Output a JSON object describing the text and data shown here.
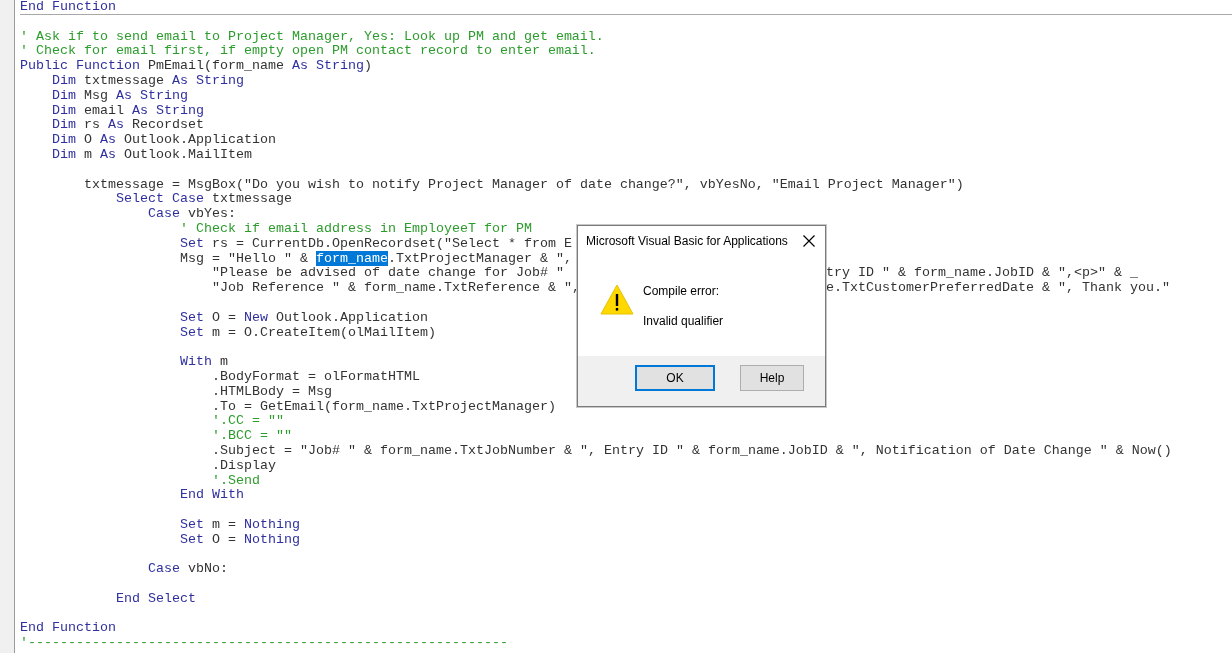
{
  "editor": {
    "lines": [
      {
        "kind": "code",
        "separator": true,
        "tokens": [
          {
            "kind": "keyword",
            "text": "End Function"
          }
        ]
      },
      {
        "kind": "blank"
      },
      {
        "kind": "code",
        "tokens": [
          {
            "kind": "comment",
            "text": "' Ask if to send email to Project Manager, Yes: Look up PM and get email."
          }
        ]
      },
      {
        "kind": "code",
        "tokens": [
          {
            "kind": "comment",
            "text": "' Check for email first, if empty open PM contact record to enter email."
          }
        ]
      },
      {
        "kind": "code",
        "tokens": [
          {
            "kind": "keyword",
            "text": "Public Function"
          },
          {
            "kind": "plain",
            "text": " PmEmail(form_name "
          },
          {
            "kind": "keyword",
            "text": "As String"
          },
          {
            "kind": "plain",
            "text": ")"
          }
        ]
      },
      {
        "kind": "block",
        "children": [
          {
            "kind": "code",
            "tokens": [
              {
                "kind": "keyword",
                "text": "Dim"
              },
              {
                "kind": "plain",
                "text": " txtmessage "
              },
              {
                "kind": "keyword",
                "text": "As String"
              }
            ]
          },
          {
            "kind": "code",
            "tokens": [
              {
                "kind": "keyword",
                "text": "Dim"
              },
              {
                "kind": "plain",
                "text": " Msg "
              },
              {
                "kind": "keyword",
                "text": "As String"
              }
            ]
          },
          {
            "kind": "code",
            "tokens": [
              {
                "kind": "keyword",
                "text": "Dim"
              },
              {
                "kind": "plain",
                "text": " email "
              },
              {
                "kind": "keyword",
                "text": "As String"
              }
            ]
          },
          {
            "kind": "code",
            "tokens": [
              {
                "kind": "keyword",
                "text": "Dim"
              },
              {
                "kind": "plain",
                "text": " rs "
              },
              {
                "kind": "keyword",
                "text": "As"
              },
              {
                "kind": "plain",
                "text": " Recordset"
              }
            ]
          },
          {
            "kind": "code",
            "tokens": [
              {
                "kind": "keyword",
                "text": "Dim"
              },
              {
                "kind": "plain",
                "text": " O "
              },
              {
                "kind": "keyword",
                "text": "As"
              },
              {
                "kind": "plain",
                "text": " Outlook.Application"
              }
            ]
          },
          {
            "kind": "code",
            "tokens": [
              {
                "kind": "keyword",
                "text": "Dim"
              },
              {
                "kind": "plain",
                "text": " m "
              },
              {
                "kind": "keyword",
                "text": "As"
              },
              {
                "kind": "plain",
                "text": " Outlook.MailItem"
              }
            ]
          },
          {
            "kind": "blank"
          },
          {
            "kind": "block",
            "children": [
              {
                "kind": "code",
                "tokens": [
                  {
                    "kind": "plain",
                    "text": "txtmessage = MsgBox(\"Do you wish to notify Project Manager of date change?\", vbYesNo, \"Email Project Manager\")"
                  }
                ]
              },
              {
                "kind": "block",
                "children": [
                  {
                    "kind": "code",
                    "tokens": [
                      {
                        "kind": "keyword",
                        "text": "Select Case"
                      },
                      {
                        "kind": "plain",
                        "text": " txtmessage"
                      }
                    ]
                  },
                  {
                    "kind": "block",
                    "children": [
                      {
                        "kind": "code",
                        "tokens": [
                          {
                            "kind": "keyword",
                            "text": "Case"
                          },
                          {
                            "kind": "plain",
                            "text": " vbYes:"
                          }
                        ]
                      },
                      {
                        "kind": "block",
                        "children": [
                          {
                            "kind": "code",
                            "tokens": [
                              {
                                "kind": "comment",
                                "text": "' Check if email address in EmployeeT for PM"
                              }
                            ]
                          },
                          {
                            "kind": "code",
                            "tokens": [
                              {
                                "kind": "keyword",
                                "text": "Set"
                              },
                              {
                                "kind": "plain",
                                "text": " rs = CurrentDb.OpenRecordset(\"Select * from E"
                              }
                            ]
                          },
                          {
                            "kind": "code",
                            "tokens": [
                              {
                                "kind": "plain",
                                "text": "Msg = \"Hello \" & "
                              },
                              {
                                "kind": "selection",
                                "text": "form_name"
                              },
                              {
                                "kind": "plain",
                                "text": ".TxtProjectManager & \","
                              }
                            ]
                          },
                          {
                            "kind": "block",
                            "children": [
                              {
                                "kind": "code",
                                "tokens": [
                                  {
                                    "kind": "plain",
                                    "text": "\"Please be advised of date change for Job# \""
                                  }
                                ],
                                "tail": [
                                  {
                                    "kind": "plain",
                                    "text": "try ID \" & form_name.JobID & \",<p>\" & _"
                                  }
                                ]
                              },
                              {
                                "kind": "code",
                                "tokens": [
                                  {
                                    "kind": "plain",
                                    "text": "\"Job Reference \" & form_name.TxtReference & \","
                                  }
                                ],
                                "tail": [
                                  {
                                    "kind": "plain",
                                    "text": "e.TxtCustomerPreferredDate & \", Thank you.\""
                                  }
                                ]
                              }
                            ]
                          },
                          {
                            "kind": "blank"
                          },
                          {
                            "kind": "code",
                            "tokens": [
                              {
                                "kind": "keyword",
                                "text": "Set"
                              },
                              {
                                "kind": "plain",
                                "text": " O = "
                              },
                              {
                                "kind": "keyword",
                                "text": "New"
                              },
                              {
                                "kind": "plain",
                                "text": " Outlook.Application"
                              }
                            ]
                          },
                          {
                            "kind": "code",
                            "tokens": [
                              {
                                "kind": "keyword",
                                "text": "Set"
                              },
                              {
                                "kind": "plain",
                                "text": " m = O.CreateItem(olMailItem)"
                              }
                            ]
                          },
                          {
                            "kind": "blank"
                          },
                          {
                            "kind": "code",
                            "tokens": [
                              {
                                "kind": "keyword",
                                "text": "With"
                              },
                              {
                                "kind": "plain",
                                "text": " m"
                              }
                            ]
                          },
                          {
                            "kind": "block",
                            "children": [
                              {
                                "kind": "code",
                                "tokens": [
                                  {
                                    "kind": "plain",
                                    "text": ".BodyFormat = olFormatHTML"
                                  }
                                ]
                              },
                              {
                                "kind": "code",
                                "tokens": [
                                  {
                                    "kind": "plain",
                                    "text": ".HTMLBody = Msg"
                                  }
                                ]
                              },
                              {
                                "kind": "code",
                                "tokens": [
                                  {
                                    "kind": "plain",
                                    "text": ".To = GetEmail(form_name.TxtProjectManager)"
                                  }
                                ]
                              },
                              {
                                "kind": "code",
                                "tokens": [
                                  {
                                    "kind": "comment",
                                    "text": "'.CC = \"\""
                                  }
                                ]
                              },
                              {
                                "kind": "code",
                                "tokens": [
                                  {
                                    "kind": "comment",
                                    "text": "'.BCC = \"\""
                                  }
                                ]
                              },
                              {
                                "kind": "code",
                                "tokens": [
                                  {
                                    "kind": "plain",
                                    "text": ".Subject = \"Job# \" & form_name.TxtJobNumber & \", Entry ID \" & form_name.JobID & \", Notification of Date Change \" & Now()"
                                  }
                                ]
                              },
                              {
                                "kind": "code",
                                "tokens": [
                                  {
                                    "kind": "plain",
                                    "text": ".Display"
                                  }
                                ]
                              },
                              {
                                "kind": "code",
                                "tokens": [
                                  {
                                    "kind": "comment",
                                    "text": "'.Send"
                                  }
                                ]
                              }
                            ]
                          },
                          {
                            "kind": "code",
                            "tokens": [
                              {
                                "kind": "keyword",
                                "text": "End With"
                              }
                            ]
                          },
                          {
                            "kind": "blank"
                          },
                          {
                            "kind": "code",
                            "tokens": [
                              {
                                "kind": "keyword",
                                "text": "Set"
                              },
                              {
                                "kind": "plain",
                                "text": " m = "
                              },
                              {
                                "kind": "keyword",
                                "text": "Nothing"
                              }
                            ]
                          },
                          {
                            "kind": "code",
                            "tokens": [
                              {
                                "kind": "keyword",
                                "text": "Set"
                              },
                              {
                                "kind": "plain",
                                "text": " O = "
                              },
                              {
                                "kind": "keyword",
                                "text": "Nothing"
                              }
                            ]
                          }
                        ]
                      },
                      {
                        "kind": "blank"
                      },
                      {
                        "kind": "code",
                        "tokens": [
                          {
                            "kind": "keyword",
                            "text": "Case"
                          },
                          {
                            "kind": "plain",
                            "text": " vbNo:"
                          }
                        ]
                      },
                      {
                        "kind": "blank"
                      }
                    ]
                  },
                  {
                    "kind": "code",
                    "tokens": [
                      {
                        "kind": "keyword",
                        "text": "End Select"
                      }
                    ]
                  }
                ]
              }
            ]
          },
          {
            "kind": "blank"
          }
        ]
      },
      {
        "kind": "code",
        "tokens": [
          {
            "kind": "keyword",
            "text": "End Function"
          }
        ]
      },
      {
        "kind": "code",
        "tokens": [
          {
            "kind": "comment",
            "text": "'------------------------------------------------------------"
          }
        ]
      }
    ]
  },
  "dialog": {
    "title": "Microsoft Visual Basic for Applications",
    "messages": [
      "Compile error:",
      "Invalid qualifier"
    ],
    "buttons": [
      {
        "label": "OK",
        "default": true
      },
      {
        "label": "Help",
        "default": false
      }
    ]
  }
}
